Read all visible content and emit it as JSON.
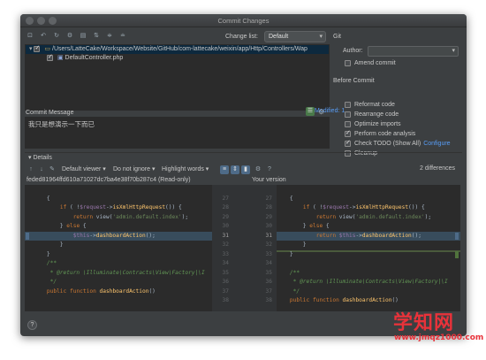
{
  "window": {
    "title": "Commit Changes"
  },
  "top": {
    "changelist_label": "Change list:",
    "changelist_value": "Default",
    "git_label": "Git"
  },
  "tree": {
    "path": "/Users/LatteCake/Workspace/Website/GitHub/com-lattecake/weixin/app/Http/Controllers/Wap",
    "file": "DefaultController.php"
  },
  "modified": "Modified: 1",
  "git": {
    "author_label": "Author:",
    "amend_label": "Amend commit",
    "before_commit": "Before Commit",
    "options": [
      {
        "label": "Reformat code",
        "checked": false
      },
      {
        "label": "Rearrange code",
        "checked": false
      },
      {
        "label": "Optimize imports",
        "checked": false
      },
      {
        "label": "Perform code analysis",
        "checked": true
      },
      {
        "label": "Check TODO (Show All)",
        "checked": true,
        "link": "Configure"
      },
      {
        "label": "Cleanup",
        "checked": false
      }
    ]
  },
  "commit": {
    "label": "Commit Message",
    "message": "我只是想演示一下而已"
  },
  "details": {
    "label": "Details",
    "viewer": "Default viewer",
    "whitespace": "Do not ignore",
    "highlight": "Highlight words",
    "differences": "2 differences",
    "left_title": "feded81964ffd610a71027dc7ba4e38f70b287c4 (Read-only)",
    "right_title": "Your version"
  },
  "diff": {
    "left_numbers": [
      "27",
      "28",
      "29",
      "30",
      "31",
      "32",
      "33",
      "34",
      "35",
      "36",
      "37",
      "38"
    ],
    "right_numbers": [
      "27",
      "28",
      "29",
      "30",
      "31",
      "32",
      "33",
      "34",
      "35",
      "36",
      "37",
      "38"
    ],
    "left_lines": [
      {
        "t": "    {"
      },
      {
        "t": "        if ( !$request->isXmlHttpRequest()) {"
      },
      {
        "t": "            return view('admin.default.index');"
      },
      {
        "t": "        } else {"
      },
      {
        "t": "            $this->dashboardAction();"
      },
      {
        "t": "        }"
      },
      {
        "t": "    }"
      },
      {
        "t": "    /**"
      },
      {
        "t": "     * @return \\Illuminate\\Contracts\\View\\Factory|\\I"
      },
      {
        "t": "     */"
      },
      {
        "t": "    public function dashboardAction()"
      },
      {
        "t": ""
      }
    ],
    "right_lines": [
      {
        "t": "    {"
      },
      {
        "t": "        if ( !$request->isXmlHttpRequest()) {"
      },
      {
        "t": "            return view('admin.default.index');"
      },
      {
        "t": "        } else {"
      },
      {
        "t": "            return $this->dashboardAction();"
      },
      {
        "t": "        }"
      },
      {
        "t": "    }"
      },
      {
        "t": ""
      },
      {
        "t": "    /**"
      },
      {
        "t": "     * @return \\Illuminate\\Contracts\\View\\Factory|\\I"
      },
      {
        "t": "     */"
      },
      {
        "t": "    public function dashboardAction()"
      }
    ]
  },
  "watermark": {
    "title": "学知网",
    "url": "www.jmqz1000.com"
  }
}
